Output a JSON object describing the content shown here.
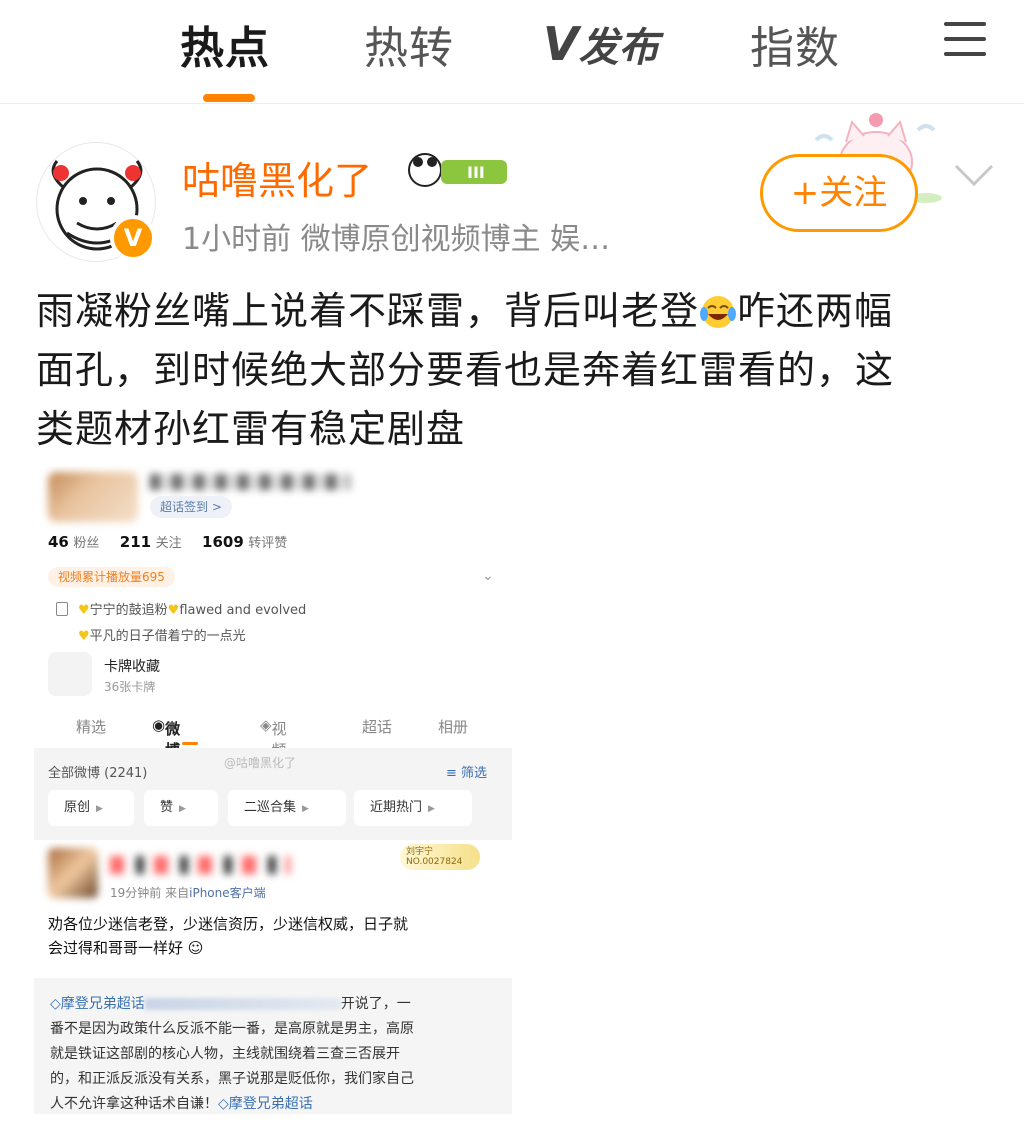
{
  "nav": {
    "tabs": [
      "热点",
      "热转",
      "发布",
      "指数"
    ],
    "active_tab": "热点",
    "brand_mark": "V"
  },
  "post": {
    "username": "咕噜黑化了",
    "level_badge": "III",
    "verified_badge": "V",
    "meta": "1小时前  微博原创视频博主 娱…",
    "follow_label": "+关注",
    "text_line1": "雨凝粉丝嘴上说着不踩雷，背后叫老登",
    "text_line1_tail": "咋还两幅",
    "text_line2": "面孔，到时候绝大部分要看也是奔着红雷看的，这",
    "text_line3": "类题材孙红雷有稳定剧盘",
    "emoji_name": "laughing-tears-emoji"
  },
  "screenshot": {
    "chip": "超话签到 >",
    "stats": {
      "fans_value": "46",
      "fans_label": "粉丝",
      "follow_value": "211",
      "follow_label": "关注",
      "likes_value": "1609",
      "likes_label": "转评赞"
    },
    "video_tag": "视频累计播放量695",
    "bio_line1": "宁宁的鼓追粉",
    "bio_line1_tail": "flawed and evolved",
    "bio_line2": "平凡的日子借着宁的一点光",
    "card_title": "卡牌收藏",
    "card_sub": "36张卡牌",
    "tabs": [
      "精选",
      "微博",
      "视频",
      "超话",
      "相册"
    ],
    "all_weibo": "全部微博 (2241)",
    "filter": "筛选",
    "watermark": "@咕噜黑化了",
    "pills": [
      "原创",
      "赞",
      "二巡合集",
      "近期热门"
    ],
    "card2_line1": "刘宇宁",
    "card2_line2": "NO.0027824",
    "time": "19分钟前",
    "source_prefix": "来自",
    "source": "iPhone客户端",
    "post2_line1": "劝各位少迷信老登，少迷信资历，少迷信权威，日子就",
    "post2_line2": "会过得和哥哥一样好",
    "quote_tag": "摩登兄弟超话",
    "quote_line1_tail": "开说了，一",
    "quote_line2": "番不是因为政策什么反派不能一番，是高原就是男主，高原",
    "quote_line3": "就是铁证这部剧的核心人物，主线就围绕着三查三否展开",
    "quote_line4": "的，和正派反派没有关系，黑子说那是贬低你，我们家自己",
    "quote_line5": "人不允许拿这种话术自谦！",
    "quote_tag2": "摩登兄弟超话"
  }
}
